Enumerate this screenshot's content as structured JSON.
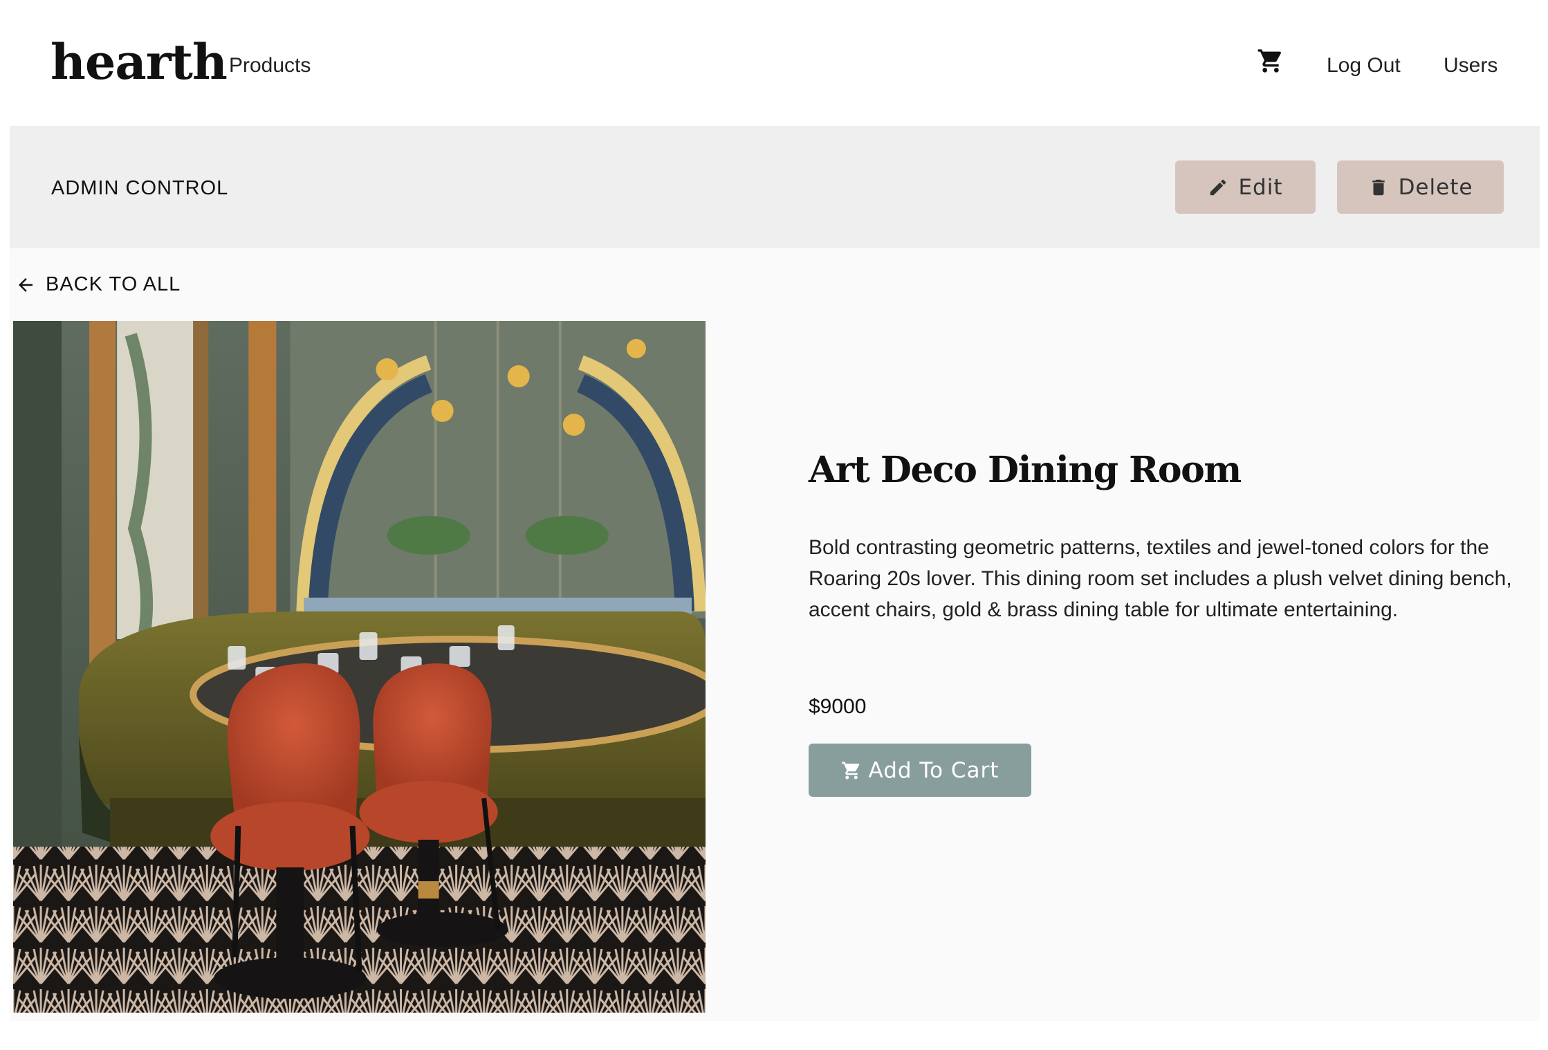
{
  "header": {
    "logo": "hearth",
    "nav_products": "Products",
    "cart_icon": "cart-icon",
    "nav_logout": "Log Out",
    "nav_users": "Users"
  },
  "admin": {
    "title": "ADMIN CONTROL",
    "edit_label": "Edit",
    "edit_icon": "pencil-icon",
    "delete_label": "Delete",
    "delete_icon": "trash-icon"
  },
  "main": {
    "back_label": "BACK TO ALL",
    "back_icon": "arrow-left-icon"
  },
  "product": {
    "title": "Art Deco Dining Room",
    "description": "Bold contrasting geometric patterns, textiles and jewel-toned colors for the Roaring 20s lover. This dining room set includes a plush velvet dining bench, accent chairs, gold & brass dining table for ultimate entertaining.",
    "price": "$9000",
    "add_to_cart_label": "Add To Cart",
    "add_to_cart_icon": "cart-icon"
  },
  "colors": {
    "admin_bar_bg": "#efefef",
    "admin_button_bg": "#d5c5bd",
    "cart_button_bg": "#889e9d",
    "main_bg": "#fafafa"
  }
}
